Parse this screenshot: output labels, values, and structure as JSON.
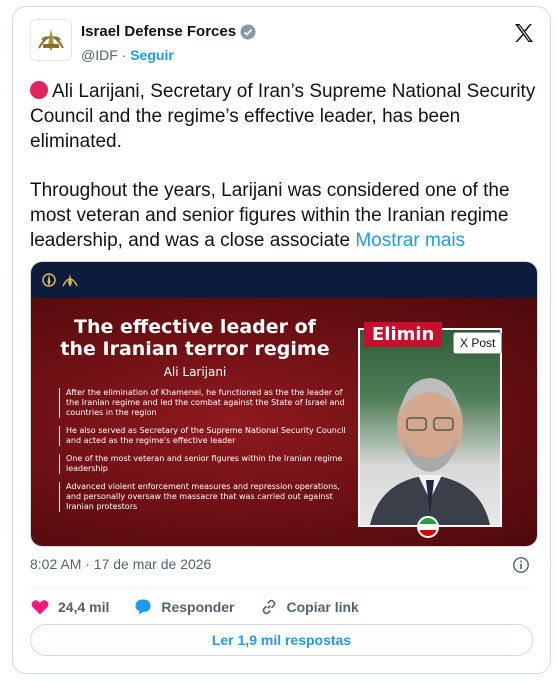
{
  "author": {
    "name": "Israel Defense Forces",
    "handle": "@IDF",
    "separator": "·",
    "follow_label": "Seguir"
  },
  "tweet": {
    "paragraph1": "Ali Larijani, Secretary of Iran’s Supreme National Security Council and the regime’s effective leader, has been eliminated.",
    "paragraph2": "Throughout the years, Larijani was considered one of the most veteran and senior figures within the Iranian regime leadership, and was a close associate",
    "show_more": "Mostrar mais"
  },
  "media": {
    "headline": "The effective leader of the Iranian terror regime",
    "subject_name": "Ali Larijani",
    "bullets": [
      "After the elimination of Khamenei, he functioned as the the leader of the Iranian regime and led the combat against the State of Israel and countries in the region",
      "He also served as Secretary of the Supreme National Security Council and acted as the regime's effective leader",
      "One of the most veteran and senior figures within the Iranian regime leadership",
      "Advanced violent enforcement measures and repression operations, and personally oversaw the massacre that was carried out against Iranian protestors"
    ],
    "badge": "Elimin",
    "tooltip": "X Post"
  },
  "meta": {
    "timestamp": "8:02 AM · 17 de mar de 2026"
  },
  "actions": {
    "likes": "24,4 mil",
    "reply": "Responder",
    "copy_link": "Copiar link"
  },
  "read_replies": "Ler 1,9 mil respostas",
  "colors": {
    "accent": "#1d9bf0",
    "like": "#f91880",
    "banner_red": "#6a0f13",
    "banner_navy": "#0d1b3d"
  }
}
